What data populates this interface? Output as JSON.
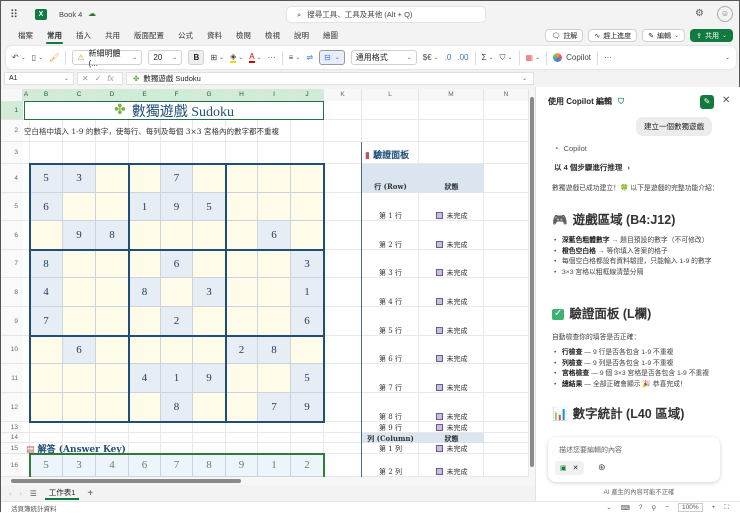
{
  "app": {
    "title": "Book 4",
    "search_placeholder": "搜尋工具、工具及其他 (Alt + Q)"
  },
  "menu_tabs": [
    "檔案",
    "常用",
    "插入",
    "共用",
    "版面配置",
    "公式",
    "資料",
    "檢閱",
    "檢視",
    "說明",
    "繪圖"
  ],
  "active_tab": 1,
  "header_buttons": {
    "comments": "註解",
    "catchup": "趕上進度",
    "editing": "編輯",
    "share": "共用"
  },
  "toolbar": {
    "font": "新細明體 (...",
    "size": "20",
    "bold": "B",
    "number_format": "通用格式",
    "currency": "$€",
    "copilot": "Copilot",
    "more": "···"
  },
  "formula_bar": {
    "name_box": "A1",
    "fx": "fx",
    "value": "數獨遊戲 Sudoku"
  },
  "colors": {
    "accent": "#117a3e",
    "board_border": "#1f4e79",
    "given": "#e6edf5",
    "empty": "#fefce8"
  },
  "columns": [
    "A",
    "B",
    "C",
    "D",
    "E",
    "F",
    "G",
    "H",
    "I",
    "J",
    "K",
    "L",
    "M",
    "N"
  ],
  "rows": [
    "1",
    "2",
    "3",
    "4",
    "5",
    "6",
    "7",
    "8",
    "9",
    "10",
    "11",
    "12",
    "13",
    "14",
    "15",
    "16"
  ],
  "sheet": {
    "title": "數獨遊戲 Sudoku",
    "instruction": "空白格中填入 1-9 的數字，使每行、每列及每個 3×3 宮格內的數字都不重複",
    "puzzle": [
      [
        5,
        3,
        0,
        0,
        7,
        0,
        0,
        0,
        0
      ],
      [
        6,
        0,
        0,
        1,
        9,
        5,
        0,
        0,
        0
      ],
      [
        0,
        9,
        8,
        0,
        0,
        0,
        0,
        6,
        0
      ],
      [
        8,
        0,
        0,
        0,
        6,
        0,
        0,
        0,
        3
      ],
      [
        4,
        0,
        0,
        8,
        0,
        3,
        0,
        0,
        1
      ],
      [
        7,
        0,
        0,
        0,
        2,
        0,
        0,
        0,
        6
      ],
      [
        0,
        6,
        0,
        0,
        0,
        0,
        2,
        8,
        0
      ],
      [
        0,
        0,
        0,
        4,
        1,
        9,
        0,
        0,
        5
      ],
      [
        0,
        0,
        0,
        0,
        8,
        0,
        0,
        7,
        9
      ]
    ],
    "answer_label": "解答 (Answer Key)",
    "answer_row": [
      5,
      3,
      4,
      6,
      7,
      8,
      9,
      1,
      2
    ],
    "verify": {
      "title": "驗證面板",
      "row_header": "行 (Row)",
      "status_header": "狀態",
      "rows": [
        "第 1 行",
        "第 2 行",
        "第 3 行",
        "第 4 行",
        "第 5 行",
        "第 6 行",
        "第 7 行",
        "第 8 行",
        "第 9 行"
      ],
      "col_header": "列 (Column)",
      "cols": [
        "第 1 列",
        "第 2 列"
      ],
      "status": "未完成"
    }
  },
  "sheet_tabs": {
    "active": "工作表1"
  },
  "statusbar": {
    "left": "活頁簿統計資料",
    "zoom": "100%"
  },
  "copilot": {
    "title": "使用 Copilot 編輯",
    "user_msg": "建立一個數獨遊戲",
    "name": "Copilot",
    "reasoning": "以 4 個步驟進行推理",
    "intro": "數獨遊戲已成功建立！🍀 以下是遊戲的完整功能介紹：",
    "s1_title": "遊戲區域 (B4:J12)",
    "s1_items": [
      [
        "深藍色粗體數字",
        "→ 題目預設的數字（不可修改）"
      ],
      [
        "橙色空白格",
        "→ 等你填入答案的格子"
      ],
      [
        "",
        "每個空白格都設有資料驗證，只能輸入 1-9 的數字"
      ],
      [
        "",
        "3×3 宮格以粗框線清楚分隔"
      ]
    ],
    "s2_title": "驗證面板 (L欄)",
    "s2_desc": "自動檢查你的填答是否正確：",
    "s2_items": [
      [
        "行檢查",
        "— 9 行是否各包含 1-9 不重複"
      ],
      [
        "列檢查",
        "— 9 列是否各包含 1-9 不重複"
      ],
      [
        "宮格檢查",
        "— 9 個 3×3 宮格是否各包含 1-9 不重複"
      ],
      [
        "總結果",
        "— 全部正確會顯示 🎉 恭喜完成！"
      ]
    ],
    "s3_title": "數字統計 (L40 區域)",
    "input_placeholder": "描述您要編輯的內容",
    "disclaimer": "AI 產生的內容可能不正確"
  }
}
